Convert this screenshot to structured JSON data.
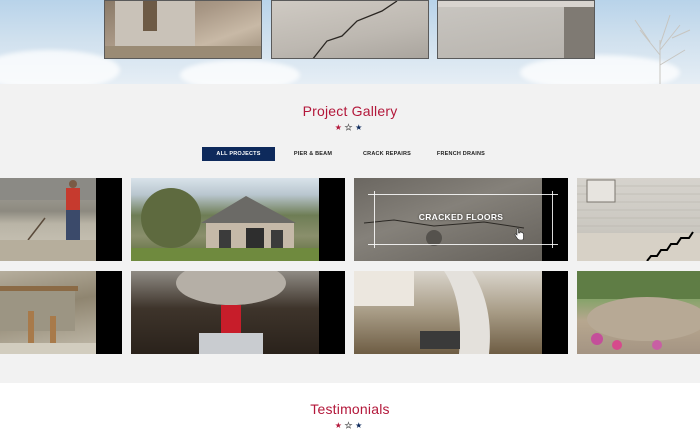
{
  "gallery": {
    "title": "Project Gallery",
    "filters": [
      {
        "label": "ALL PROJECTS",
        "active": true
      },
      {
        "label": "PIER & BEAM",
        "active": false
      },
      {
        "label": "CRACK REPAIRS",
        "active": false
      },
      {
        "label": "FRENCH DRAINS",
        "active": false
      }
    ],
    "hover_tile_label": "CRACKED FLOORS"
  },
  "testimonials": {
    "title": "Testimonials"
  },
  "colors": {
    "accent_red": "#b3173a",
    "navy": "#0e2a5c",
    "section_bg": "#f2f2f2"
  },
  "icons": {
    "star_rating": [
      "star-red-icon",
      "star-white-icon",
      "star-blue-icon"
    ],
    "cursor": "hand-pointer-icon"
  }
}
